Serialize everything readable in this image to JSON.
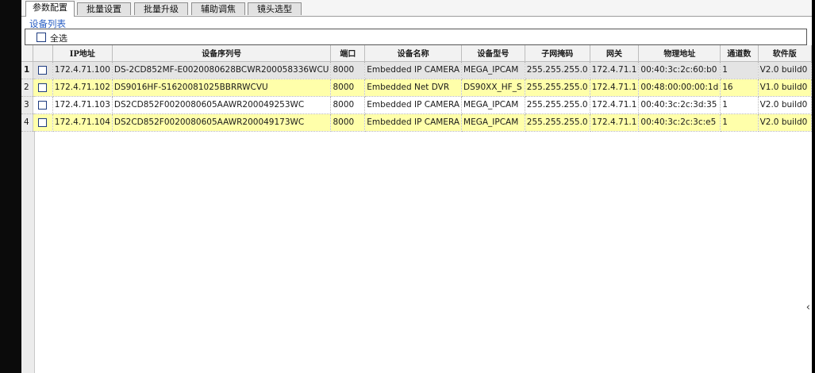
{
  "tabs": [
    {
      "label": "参数配置",
      "active": true
    },
    {
      "label": "批量设置",
      "active": false
    },
    {
      "label": "批量升级",
      "active": false
    },
    {
      "label": "辅助调焦",
      "active": false
    },
    {
      "label": "镜头选型",
      "active": false
    }
  ],
  "group_label": "设备列表",
  "select_all_label": "全选",
  "columns": [
    "IP地址",
    "设备序列号",
    "端口",
    "设备名称",
    "设备型号",
    "子网掩码",
    "网关",
    "物理地址",
    "通道数",
    "软件版"
  ],
  "rows": [
    {
      "num": "1",
      "ip": "172.4.71.100",
      "serial": "DS-2CD852MF-E0020080628BCWR200058336WCU",
      "port": "8000",
      "name": "Embedded IP CAMERA",
      "model": "MEGA_IPCAM",
      "mask": "255.255.255.0",
      "gateway": "172.4.71.1",
      "mac": "00:40:3c:2c:60:b0",
      "channels": "1",
      "version": "V2.0 build0"
    },
    {
      "num": "2",
      "ip": "172.4.71.102",
      "serial": "DS9016HF-S1620081025BBRRWCVU",
      "port": "8000",
      "name": "Embedded Net DVR",
      "model": "DS90XX_HF_S",
      "mask": "255.255.255.0",
      "gateway": "172.4.71.1",
      "mac": "00:48:00:00:00:1d",
      "channels": "16",
      "version": "V1.0 build0"
    },
    {
      "num": "3",
      "ip": "172.4.71.103",
      "serial": "DS2CD852F0020080605AAWR200049253WC",
      "port": "8000",
      "name": "Embedded IP CAMERA",
      "model": "MEGA_IPCAM",
      "mask": "255.255.255.0",
      "gateway": "172.4.71.1",
      "mac": "00:40:3c:2c:3d:35",
      "channels": "1",
      "version": "V2.0 build0"
    },
    {
      "num": "4",
      "ip": "172.4.71.104",
      "serial": "DS2CD852F0020080605AAWR200049173WC",
      "port": "8000",
      "name": "Embedded IP CAMERA",
      "model": "MEGA_IPCAM",
      "mask": "255.255.255.0",
      "gateway": "172.4.71.1",
      "mac": "00:40:3c:2c:3c:e5",
      "channels": "1",
      "version": "V2.0 build0"
    }
  ],
  "scroll_arrow_glyph": "‹",
  "colors": {
    "highlight_row": "#ffffaa",
    "selected_row": "#e4e4e4",
    "group_label": "#2a5fc4"
  }
}
